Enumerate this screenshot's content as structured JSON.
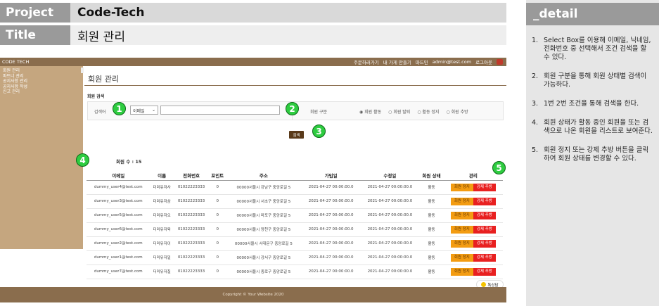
{
  "header": {
    "project_label": "Project",
    "project_value": "Code-Tech",
    "title_label": "Title",
    "title_value": "회원 관리"
  },
  "detail": {
    "heading": "_detail",
    "items": [
      {
        "num": "1.",
        "text": "Select Box를 이용해 이메일, 닉네임, 전화번호 중 선택해서 조건 검색을 할 수 있다."
      },
      {
        "num": "2.",
        "text": "회원 구분을 통해 회원 상태별 검색이 가능하다."
      },
      {
        "num": "3.",
        "text": "1번 2번 조건을 통해 검색을 한다."
      },
      {
        "num": "4.",
        "text": "회원 상태가 활동 중인 회원을 또는 검색으로 나온 회원을 리스트로 보여준다."
      },
      {
        "num": "5.",
        "text": "회원 정지 또는 강제 추방 버튼을 클릭하여 회원 상태를 변경할 수 있다."
      }
    ]
  },
  "app": {
    "brand": "CODE TECH",
    "top_links": [
      "주문하러가기",
      "내 가게 만들기",
      "마드민",
      "admin@test.com",
      "로그아웃"
    ],
    "sidebar": [
      "회원 관리",
      "파트너 관리",
      "공지사항 관리",
      "공지사항 작성",
      "신고 관리"
    ],
    "page_title": "회원 관리",
    "search_title": "회원 검색",
    "search_label": "검색어",
    "select_value": "이메일",
    "search_value": "",
    "member_type_label": "회원 구분",
    "radios": [
      "회원 활동",
      "회원 탈퇴",
      "활동 정지",
      "회원 추방"
    ],
    "search_button": "검색",
    "count_text": "회원 수 : 15",
    "columns": [
      "이메일",
      "이름",
      "전화번호",
      "포인트",
      "주소",
      "가입일",
      "수정일",
      "회원 상태",
      "관리"
    ],
    "rows": [
      [
        "dummy_user4@test.com",
        "더미유저사",
        "01022223333",
        "0",
        "00000서울시 강남구 중앙로길 5",
        "2021-04-27 00:00:00.0",
        "2021-04-27 00:00:00.0",
        "활동"
      ],
      [
        "dummy_user3@test.com",
        "더미유저삼",
        "01022223333",
        "0",
        "00000서울시 서초구 중앙로길 5",
        "2021-04-27 00:00:00.0",
        "2021-04-27 00:00:00.0",
        "활동"
      ],
      [
        "dummy_user5@test.com",
        "더미유저오",
        "01022223333",
        "0",
        "00000서울시 마포구 중앙로길 5",
        "2021-04-27 00:00:00.0",
        "2021-04-27 00:00:00.0",
        "활동"
      ],
      [
        "dummy_user6@test.com",
        "더미유저육",
        "01022223333",
        "0",
        "00000서울시 양천구 중앙로길 5",
        "2021-04-27 00:00:00.0",
        "2021-04-27 00:00:00.0",
        "활동"
      ],
      [
        "dummy_user2@test.com",
        "더미유저이",
        "01022223333",
        "0",
        "00000서울시 서대문구 중앙로길 5",
        "2021-04-27 00:00:00.0",
        "2021-04-27 00:00:00.0",
        "활동"
      ],
      [
        "dummy_user1@test.com",
        "더미유저일",
        "01022223333",
        "0",
        "00000서울시 강서구 중앙로길 5",
        "2021-04-27 00:00:00.0",
        "2021-04-27 00:00:00.0",
        "활동"
      ],
      [
        "dummy_user7@test.com",
        "더미유저칠",
        "01022223333",
        "0",
        "00000서울시 종로구 중앙로길 5",
        "2021-04-27 00:00:00.0",
        "2021-04-27 00:00:00.0",
        "활동"
      ]
    ],
    "stop_button": "회원 정지",
    "ban_button": "강제 추방",
    "chat_button": "톡상담",
    "footer": "Copyright © Your Website 2020"
  },
  "callouts": [
    "1",
    "2",
    "3",
    "4",
    "5"
  ]
}
